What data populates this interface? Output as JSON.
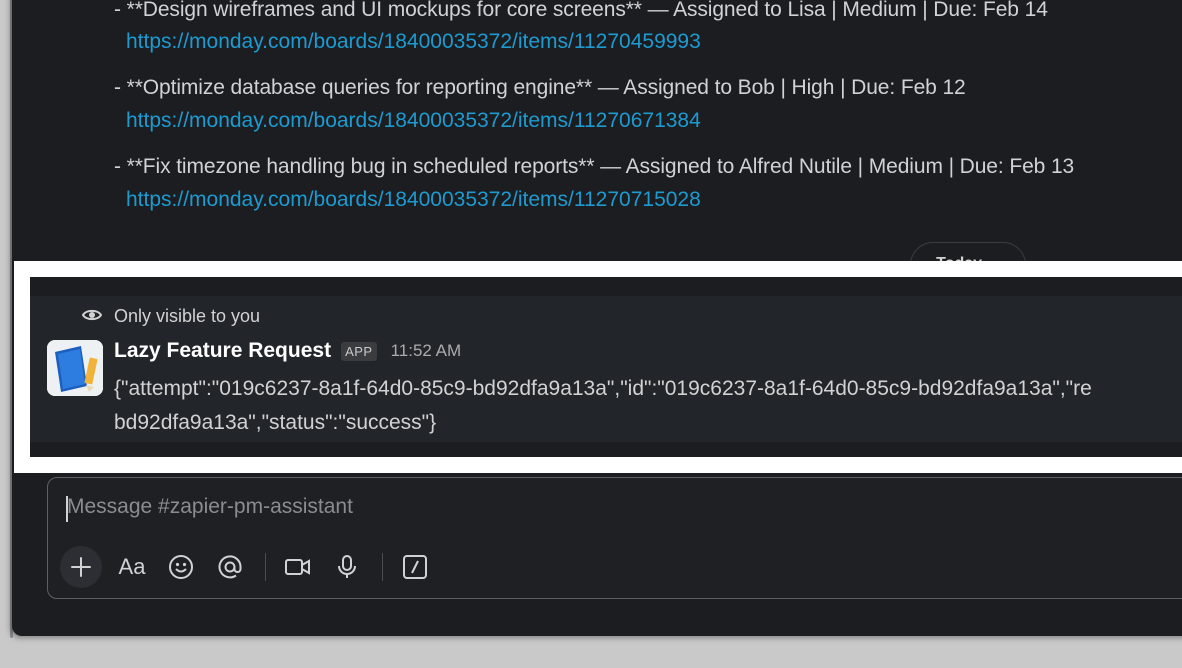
{
  "tasks": [
    {
      "text": "- **Design wireframes and UI mockups for core screens** — Assigned to Lisa | Medium | Due: Feb 14",
      "link": "https://monday.com/boards/18400035372/items/11270459993"
    },
    {
      "text": "- **Optimize database queries for reporting engine** — Assigned to Bob | High | Due: Feb 12",
      "link": "https://monday.com/boards/18400035372/items/11270671384"
    },
    {
      "text": "- **Fix timezone handling bug in scheduled reports** — Assigned to Alfred Nutile | Medium | Due: Feb 13",
      "link": "https://monday.com/boards/18400035372/items/11270715028"
    }
  ],
  "date_divider": "Today ⌄",
  "message": {
    "visibility": "Only visible to you",
    "sender": "Lazy Feature Request",
    "badge": "APP",
    "time": "11:52 AM",
    "body_line1": "{\"attempt\":\"019c6237-8a1f-64d0-85c9-bd92dfa9a13a\",\"id\":\"019c6237-8a1f-64d0-85c9-bd92dfa9a13a\",\"re",
    "body_line2": "bd92dfa9a13a\",\"status\":\"success\"}"
  },
  "composer": {
    "placeholder": "Message #zapier-pm-assistant",
    "format_label": "Aa",
    "icons": [
      "plus-icon",
      "format-icon",
      "emoji-icon",
      "mention-icon",
      "video-icon",
      "microphone-icon",
      "shortcuts-icon"
    ]
  },
  "colors": {
    "background": "#1b1d21",
    "link": "#1d9bd1",
    "highlight_border": "#ffffff"
  }
}
